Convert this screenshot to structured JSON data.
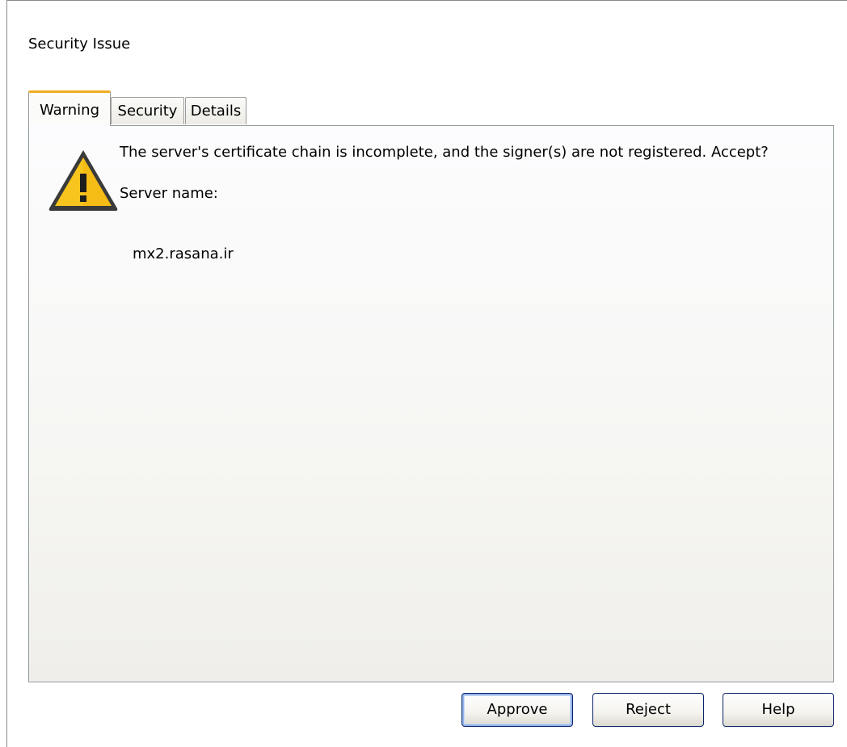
{
  "dialog": {
    "title": "Security Issue"
  },
  "tabs": [
    {
      "label": "Warning",
      "active": true
    },
    {
      "label": "Security",
      "active": false
    },
    {
      "label": "Details",
      "active": false
    }
  ],
  "warning": {
    "icon": "warning-triangle-icon",
    "message": "The server's certificate chain is incomplete, and the signer(s) are not registered. Accept?",
    "server_name_label": "Server name:",
    "server_name_value": "mx2.rasana.ir"
  },
  "buttons": {
    "approve": "Approve",
    "reject": "Reject",
    "help": "Help"
  },
  "colors": {
    "active_tab_accent": "#f0ac24",
    "warning_yellow": "#f7c51d",
    "default_button_border": "#0a2468"
  }
}
